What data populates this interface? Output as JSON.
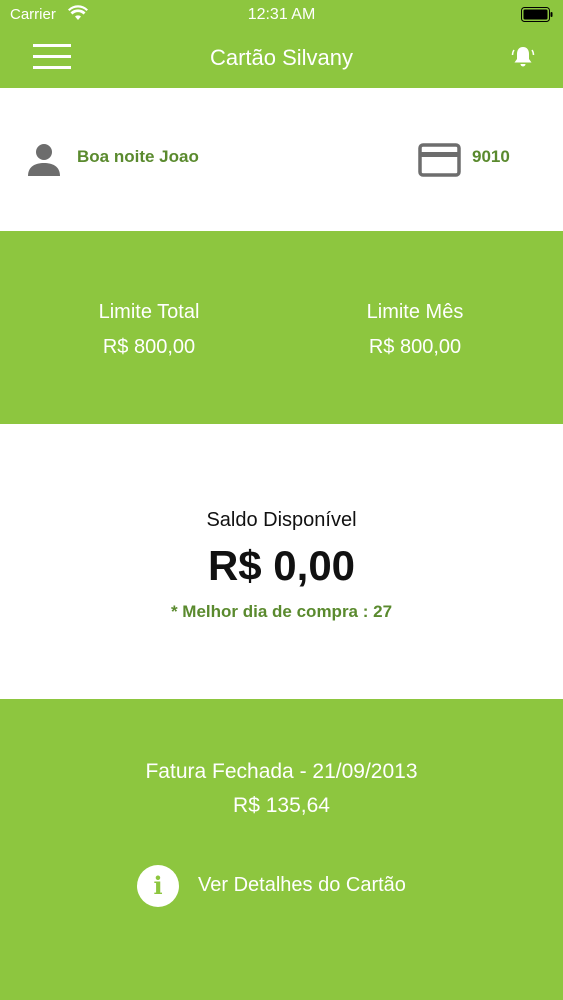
{
  "status_bar": {
    "carrier": "Carrier",
    "time": "12:31 AM",
    "icons": [
      "wifi-icon",
      "battery-icon"
    ]
  },
  "nav": {
    "title": "Cartão Silvany",
    "icons": [
      "menu-icon",
      "bell-icon"
    ]
  },
  "user": {
    "greeting": "Boa noite Joao",
    "card_number": "9010",
    "icons": [
      "person-icon",
      "credit-card-icon"
    ]
  },
  "limits": {
    "total_label": "Limite Total",
    "total_value": "R$ 800,00",
    "month_label": "Limite Mês",
    "month_value": "R$ 800,00"
  },
  "balance": {
    "label": "Saldo Disponível",
    "amount": "R$ 0,00",
    "best_day": "* Melhor dia de compra : 27"
  },
  "invoice": {
    "label": "Fatura Fechada - 21/09/2013",
    "amount": "R$ 135,64",
    "details_label": "Ver Detalhes do Cartão",
    "icon": "info-icon"
  },
  "colors": {
    "brand_green": "#8dc63f",
    "text_green": "#5a8a2e"
  }
}
